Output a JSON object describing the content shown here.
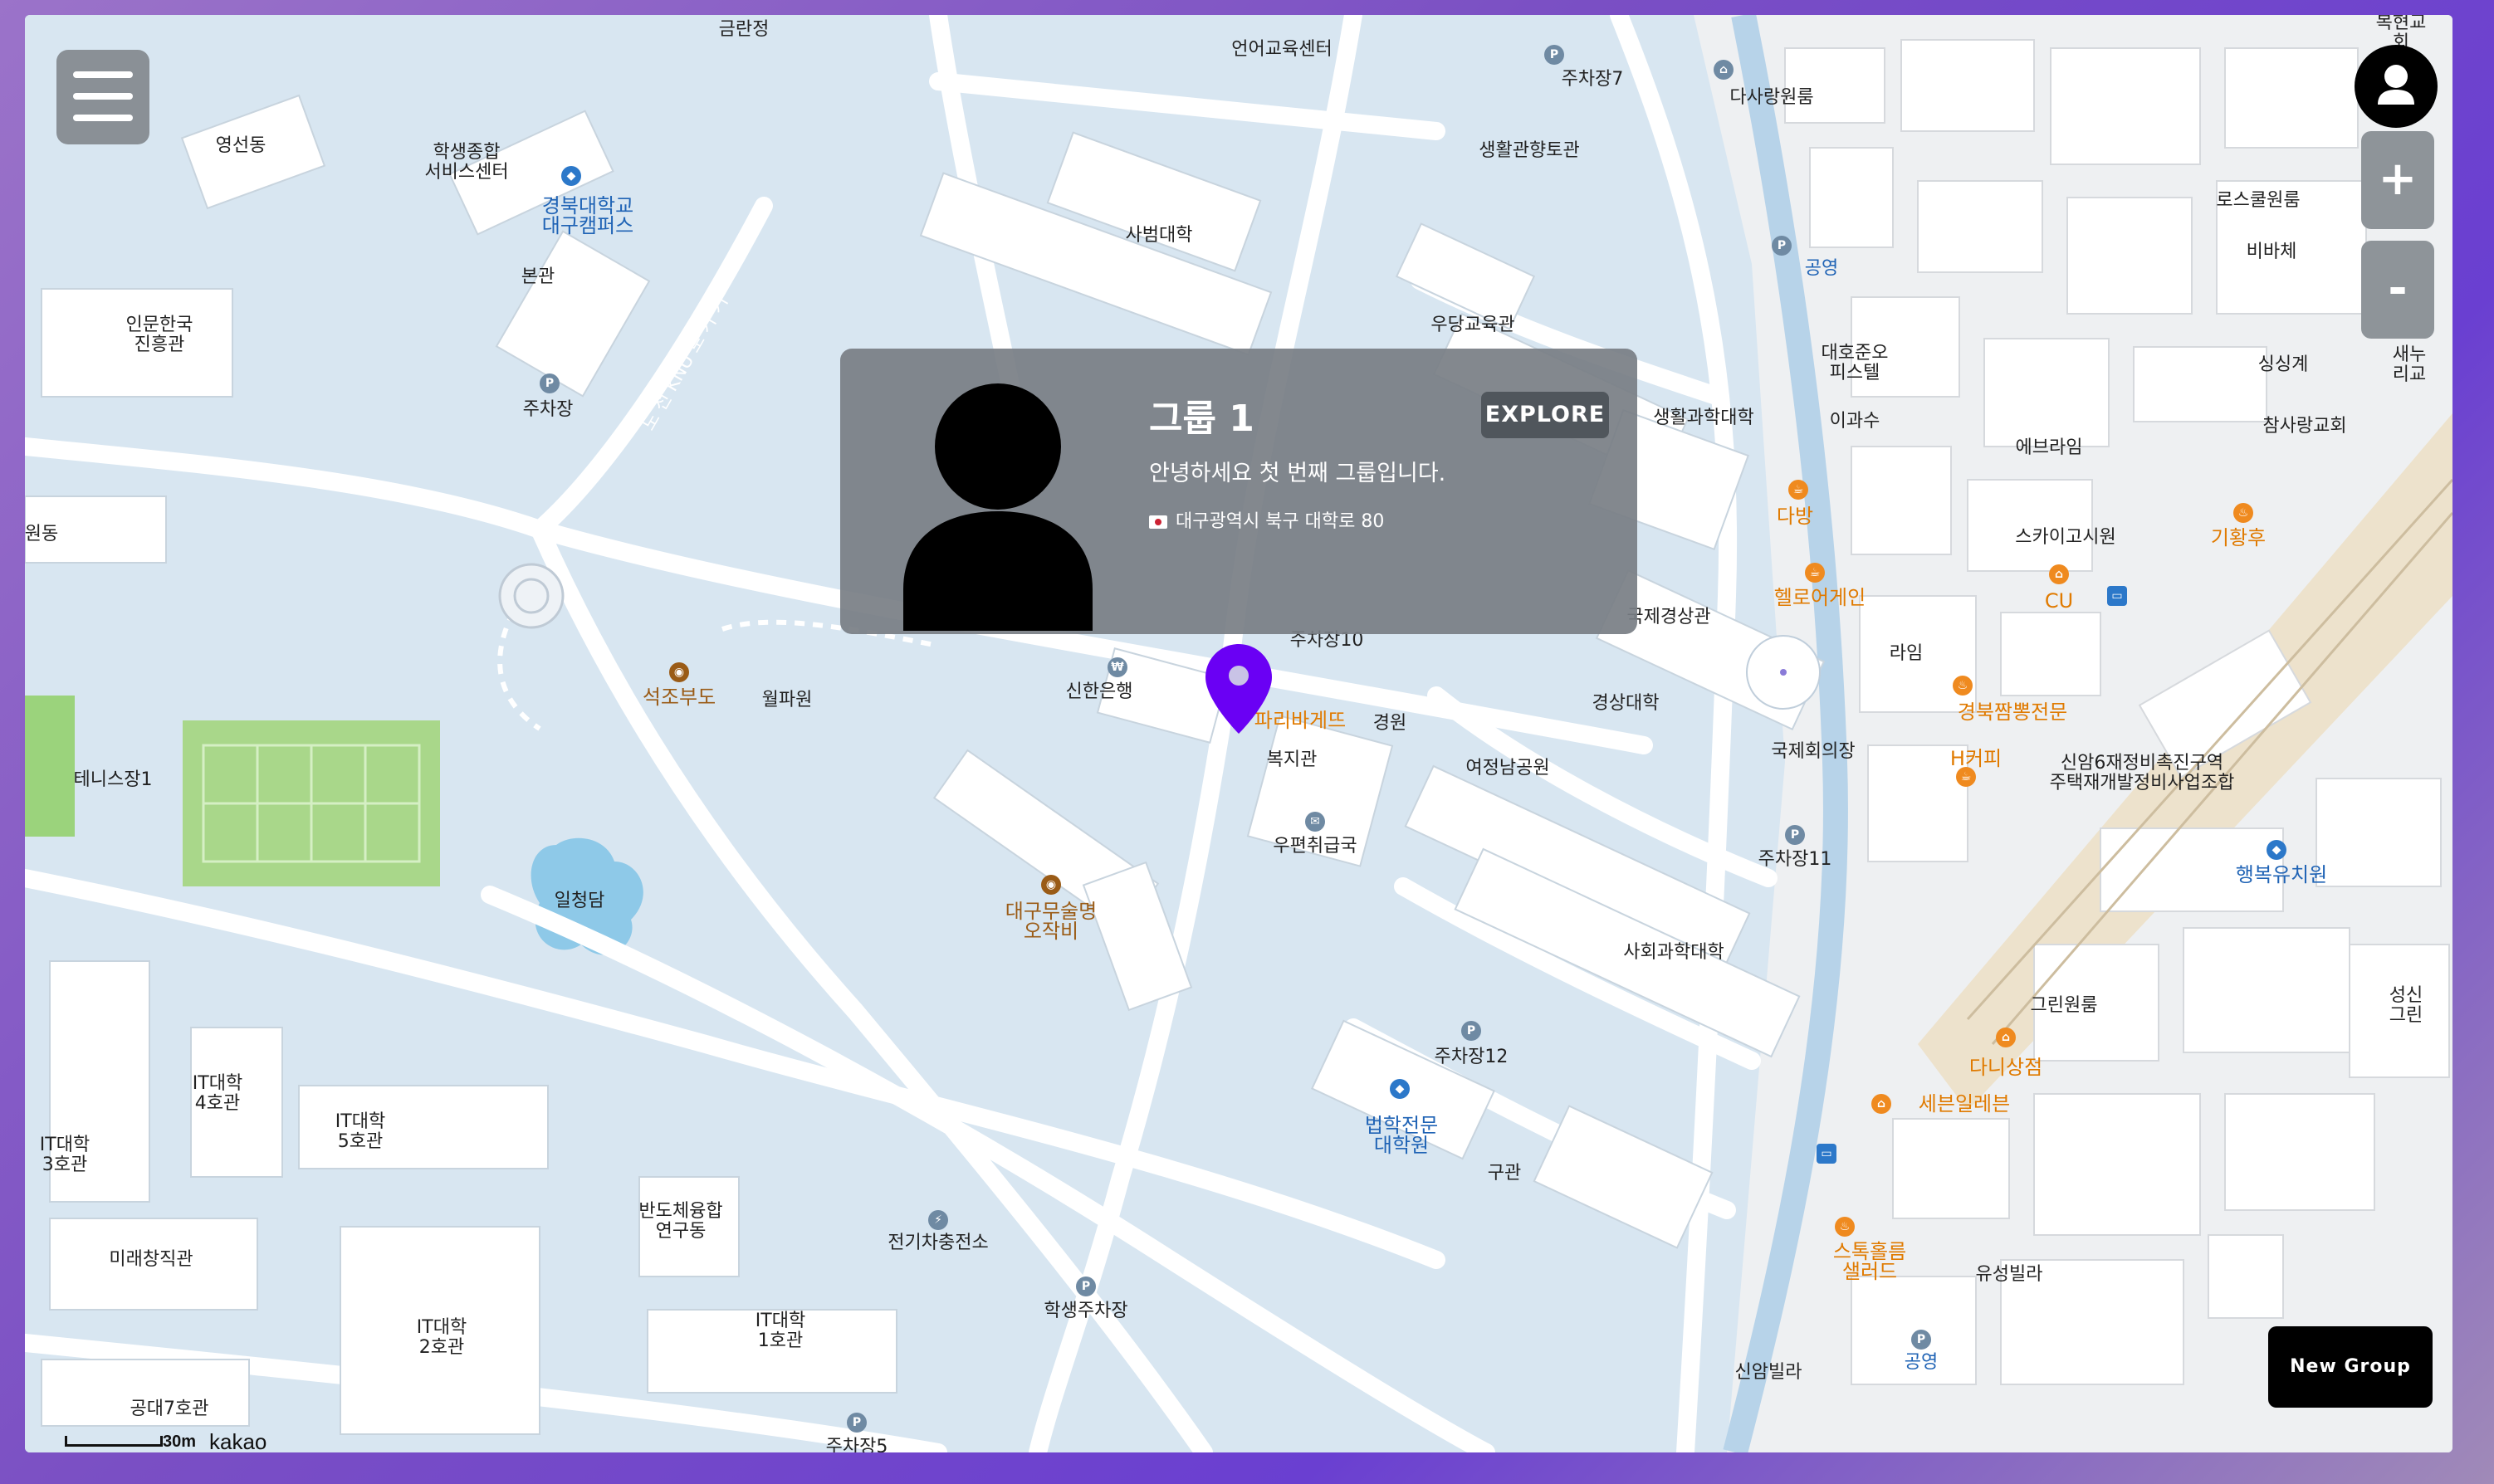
{
  "group_card": {
    "title": "그룹 1",
    "description": "안녕하세요 첫 번째 그룹입니다.",
    "address": "대구광역시 북구 대학로 80",
    "explore_label": "EXPLORE"
  },
  "controls": {
    "zoom_in_label": "+",
    "zoom_out_label": "-",
    "new_group_label": "New Group"
  },
  "map": {
    "scale_label": "30m",
    "attribution": "kakao",
    "labels": {
      "geumnyeongjeong": "금란정",
      "eoneo": "언어교육센터",
      "jucha7": "주차장7",
      "dasarang": "다사랑원룸",
      "bokhyeon": "복현교회",
      "yeongseondong": "영선동",
      "haksaeng": "학생종합\n서비스센터",
      "knu": "경북대학교\n대구캠퍼스",
      "saengwal": "생활관향토관",
      "sabeom": "사범대학",
      "rosekul": "로스쿨원룸",
      "bibache": "비바체",
      "bongwan": "본관",
      "ingmunhanguk": "인문한국\n진흥관",
      "gongyeong1": "공영",
      "daehojunoh": "대호준오\n피스텔",
      "woodang": "우당교육관",
      "singsinggye": "싱싱계",
      "saenuri": "새누리교",
      "juchajang_b": "주차장",
      "knu_road": "도 전 KNU 로 가 기",
      "igwasu": "이과수",
      "saenghwal_science": "생활과학대학",
      "chamsarang": "참사랑교회",
      "ebraim": "에브라임",
      "dabang": "다방",
      "skykosi": "스카이고시원",
      "gihwanghu": "기황후",
      "wondong": "원동",
      "hello": "헬로어게인",
      "cu": "CU",
      "gukjegyeongsang": "국제경상관",
      "juchajang10": "주차장10",
      "raim": "라임",
      "seokjobudo": "석조부도",
      "wolpa": "월파원",
      "shinhan": "신한은행",
      "paris": "파리바게뜨",
      "gyeongwon": "경원",
      "gyeongsang_univ": "경상대학",
      "jjambbong": "경북짬뽕전문",
      "gukjehoe": "국제회의장",
      "hcoffee": "H커피",
      "sinam6": "신암6재정비촉진구역\n주택재개발정비사업조합",
      "tennis": "테니스장1",
      "bokji": "복지관",
      "yeojeong": "여정남공원",
      "ujeon": "우편취급국",
      "juchajang11": "주차장11",
      "haengbok": "행복유치원",
      "ilcheongdam": "일청담",
      "daegu_musul": "대구무술명\n오작비",
      "sahoe": "사회과학대학",
      "grin": "그린원룸",
      "seongsin": "성신그린",
      "juchajang12": "주차장12",
      "dani": "다니상점",
      "it4": "IT대학\n4호관",
      "it5": "IT대학\n5호관",
      "beophak": "법학전문\n대학원",
      "seven": "세븐일레븐",
      "it3": "IT대학\n3호관",
      "gugwan": "구관",
      "bando": "반도체융합\n연구동",
      "jeongi": "전기차충전소",
      "mirae": "미래창직관",
      "stock": "스톡홀름\n샐러드",
      "yuseong": "유성빌라",
      "it2": "IT대학\n2호관",
      "it1": "IT대학\n1호관",
      "haksaeng_parking": "학생주차장",
      "gongyeong2": "공영",
      "sinam_villa": "신암빌라",
      "gongdae7": "공대7호관",
      "juchajang5": "주차장5"
    }
  },
  "colors": {
    "accent_pin": "#6a00f4",
    "card_bg": "#787e84",
    "button_dark": "#000000"
  }
}
